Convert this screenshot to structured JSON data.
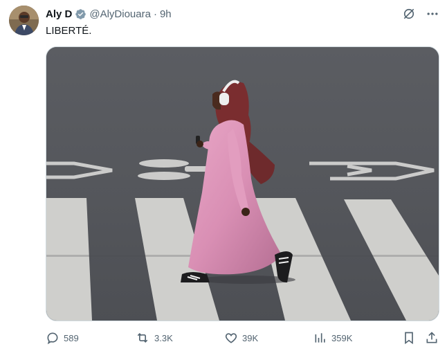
{
  "tweet": {
    "author_name": "Aly D",
    "handle": "@AlyDiouara",
    "separator": "·",
    "time": "9h",
    "text": "LIBERTÉ."
  },
  "icons": {
    "verified": "verified-badge-icon",
    "grok": "grok-icon",
    "more": "more-options-icon",
    "reply": "reply-icon",
    "retweet": "retweet-icon",
    "like": "like-icon",
    "views": "views-icon",
    "bookmark": "bookmark-icon",
    "share": "share-icon"
  },
  "metrics": {
    "replies": "589",
    "retweets": "3.3K",
    "likes": "39K",
    "views": "359K"
  },
  "colors": {
    "text": "#0f1419",
    "secondary": "#536471",
    "verified": "#829aab",
    "asphalt": "#56585d",
    "dress": "#d98fb4",
    "hijab": "#7a2d2f"
  }
}
